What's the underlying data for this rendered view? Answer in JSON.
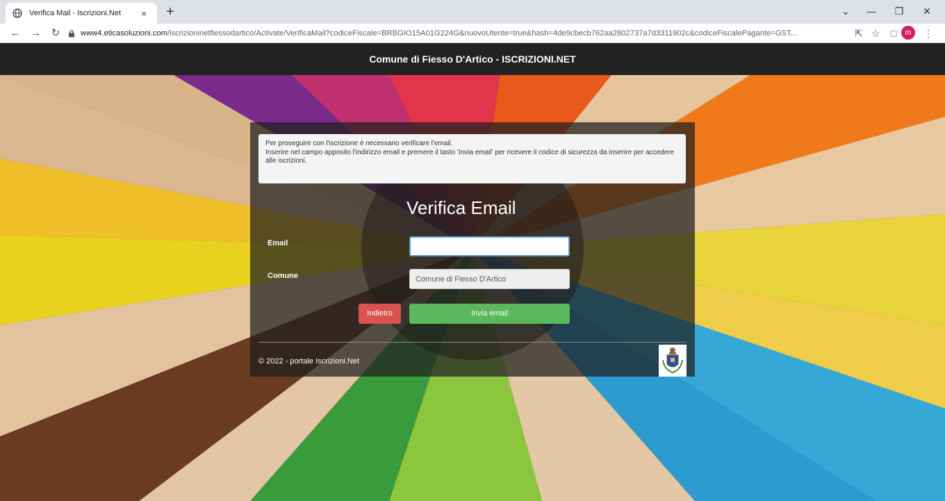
{
  "browser": {
    "tab_title": "Verifica Mail - Iscrizioni.Net",
    "tab_close": "×",
    "new_tab": "+",
    "url_host": "www4.eticasoluzioni.com",
    "url_path": "/iscrizioninetfiessodartico/Activate/VerificaMail?codiceFiscale=BRBGIO15A01G224G&nuovoUtente=true&hash=4de9cbecb762aa2802737a7d3311902c&codiceFiscalePagante=GST...",
    "profile_initial": "m",
    "icons": [
      "globe-icon",
      "back-icon",
      "forward-icon",
      "reload-icon",
      "lock-icon",
      "share-icon",
      "star-icon",
      "sidepanel-icon",
      "menu-icon",
      "minimize-icon",
      "restore-icon",
      "close-icon",
      "tab-search-icon"
    ]
  },
  "header": {
    "title": "Comune di Fiesso D'Artico - ISCRIZIONI.NET"
  },
  "notice": {
    "line1": "Per proseguire con l'iscrizione è necessario verificare l'email.",
    "line2": "Inserire nel campo apposito l'indirizzo email e premere il tasto 'Invia email' per ricevere il codice di sicurezza da inserire per accedere alle iscrizioni."
  },
  "form": {
    "title": "Verifica Email",
    "email_label": "Email",
    "email_value": "",
    "comune_label": "Comune",
    "comune_value": "Comune di Fiesso D'Artico",
    "back_label": "Indietro",
    "send_label": "Invia email"
  },
  "footer": {
    "text": "© 2022 - portale Iscrizioni.Net"
  },
  "colors": {
    "header_bg": "#222222",
    "back_button": "#d9534f",
    "send_button": "#5cb85c",
    "profile": "#d81b60"
  }
}
